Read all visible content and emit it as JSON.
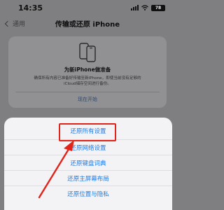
{
  "status_bar": {
    "time": "14:35",
    "battery": "78"
  },
  "nav": {
    "back_label": "通用",
    "title": "传输或还原 iPhone"
  },
  "prepare_card": {
    "heading": "为新iPhone做准备",
    "description": "确保所有内容已准备好传输至新iPhone，即使当前没有足够的iCloud储存空间进行备份。",
    "action": "现在开始"
  },
  "action_sheet": {
    "items": [
      {
        "label": "还原所有设置"
      },
      {
        "label": "还原网络设置"
      },
      {
        "label": "还原键盘词典"
      },
      {
        "label": "还原主屏幕布局"
      },
      {
        "label": "还原位置与隐私"
      }
    ]
  },
  "colors": {
    "accent": "#1f7ae6",
    "annotation": "#e2231a"
  }
}
